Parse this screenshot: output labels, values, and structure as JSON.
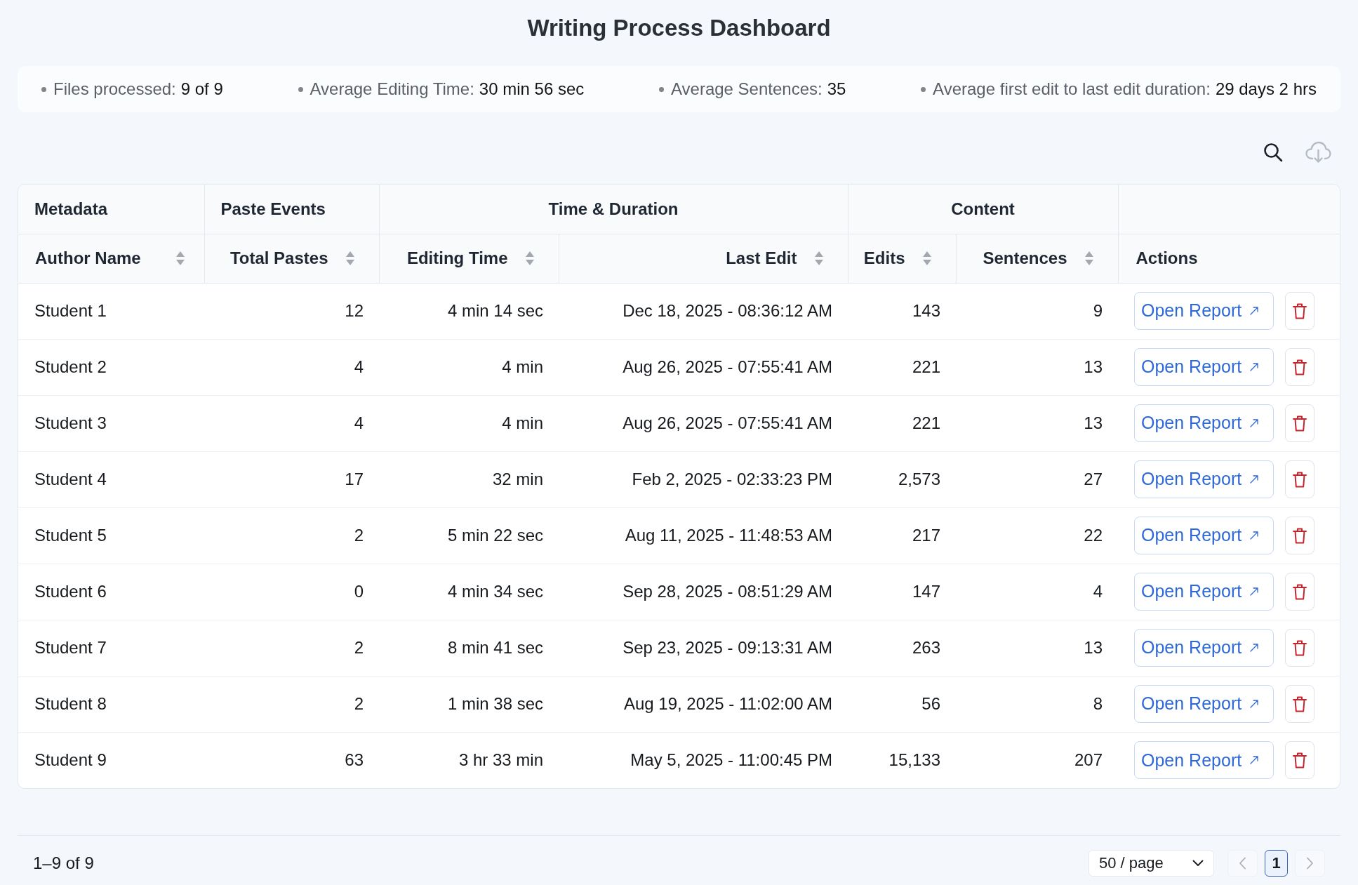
{
  "title": "Writing Process Dashboard",
  "summary": [
    {
      "label": "Files processed:",
      "value": "9 of 9"
    },
    {
      "label": "Average Editing Time:",
      "value": "30 min 56 sec"
    },
    {
      "label": "Average Sentences:",
      "value": "35"
    },
    {
      "label": "Average first edit to last edit duration:",
      "value": "29 days 2 hrs"
    }
  ],
  "toolbar": [
    {
      "kind": "search",
      "disabled": false
    },
    {
      "kind": "download",
      "disabled": true
    }
  ],
  "table": {
    "column_groups": [
      {
        "label": "Metadata",
        "columns": [
          {
            "label": "Author Name",
            "kind": "text",
            "sortable": true
          }
        ]
      },
      {
        "label": "Paste Events",
        "columns": [
          {
            "label": "Total Pastes",
            "kind": "number",
            "sortable": true
          }
        ]
      },
      {
        "label": "Time & Duration",
        "columns": [
          {
            "label": "Editing Time",
            "kind": "number",
            "sortable": true
          },
          {
            "label": "Last Edit",
            "kind": "number",
            "sortable": true
          }
        ]
      },
      {
        "label": "Content",
        "columns": [
          {
            "label": "Edits",
            "kind": "number",
            "sortable": true
          },
          {
            "label": "Sentences",
            "kind": "number",
            "sortable": true
          }
        ]
      },
      {
        "columns": [
          {
            "label": "Actions",
            "kind": "actions",
            "sortable": false
          }
        ]
      }
    ],
    "rows": [
      {
        "cells": [
          "Student 1",
          "12",
          "4 min 14 sec",
          "Dec 18, 2025 - 08:36:12 AM",
          "143",
          "9"
        ],
        "report_button": "Open Report"
      },
      {
        "cells": [
          "Student 2",
          "4",
          "4 min",
          "Aug 26, 2025 - 07:55:41 AM",
          "221",
          "13"
        ],
        "report_button": "Open Report"
      },
      {
        "cells": [
          "Student 3",
          "4",
          "4 min",
          "Aug 26, 2025 - 07:55:41 AM",
          "221",
          "13"
        ],
        "report_button": "Open Report"
      },
      {
        "cells": [
          "Student 4",
          "17",
          "32 min",
          "Feb 2, 2025 - 02:33:23 PM",
          "2,573",
          "27"
        ],
        "report_button": "Open Report"
      },
      {
        "cells": [
          "Student 5",
          "2",
          "5 min 22 sec",
          "Aug 11, 2025 - 11:48:53 AM",
          "217",
          "22"
        ],
        "report_button": "Open Report"
      },
      {
        "cells": [
          "Student 6",
          "0",
          "4 min 34 sec",
          "Sep 28, 2025 - 08:51:29 AM",
          "147",
          "4"
        ],
        "report_button": "Open Report"
      },
      {
        "cells": [
          "Student 7",
          "2",
          "8 min 41 sec",
          "Sep 23, 2025 - 09:13:31 AM",
          "263",
          "13"
        ],
        "report_button": "Open Report"
      },
      {
        "cells": [
          "Student 8",
          "2",
          "1 min 38 sec",
          "Aug 19, 2025 - 11:02:00 AM",
          "56",
          "8"
        ],
        "report_button": "Open Report"
      },
      {
        "cells": [
          "Student 9",
          "63",
          "3 hr 33 min",
          "May 5, 2025 - 11:00:45 PM",
          "15,133",
          "207"
        ],
        "report_button": "Open Report"
      }
    ]
  },
  "pagination": {
    "range": "1–9 of 9",
    "page_size": "50 / page",
    "prev": {
      "disabled": true
    },
    "pages": [
      {
        "label": "1",
        "selected": true
      }
    ],
    "next": {
      "disabled": true
    }
  }
}
